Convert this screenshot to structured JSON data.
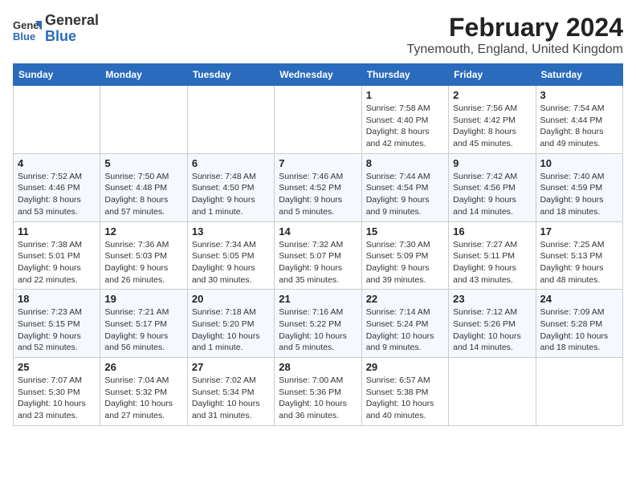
{
  "logo": {
    "general": "General",
    "blue": "Blue"
  },
  "title": "February 2024",
  "subtitle": "Tynemouth, England, United Kingdom",
  "columns": [
    "Sunday",
    "Monday",
    "Tuesday",
    "Wednesday",
    "Thursday",
    "Friday",
    "Saturday"
  ],
  "weeks": [
    [
      {
        "day": "",
        "info": ""
      },
      {
        "day": "",
        "info": ""
      },
      {
        "day": "",
        "info": ""
      },
      {
        "day": "",
        "info": ""
      },
      {
        "day": "1",
        "info": "Sunrise: 7:58 AM\nSunset: 4:40 PM\nDaylight: 8 hours\nand 42 minutes."
      },
      {
        "day": "2",
        "info": "Sunrise: 7:56 AM\nSunset: 4:42 PM\nDaylight: 8 hours\nand 45 minutes."
      },
      {
        "day": "3",
        "info": "Sunrise: 7:54 AM\nSunset: 4:44 PM\nDaylight: 8 hours\nand 49 minutes."
      }
    ],
    [
      {
        "day": "4",
        "info": "Sunrise: 7:52 AM\nSunset: 4:46 PM\nDaylight: 8 hours\nand 53 minutes."
      },
      {
        "day": "5",
        "info": "Sunrise: 7:50 AM\nSunset: 4:48 PM\nDaylight: 8 hours\nand 57 minutes."
      },
      {
        "day": "6",
        "info": "Sunrise: 7:48 AM\nSunset: 4:50 PM\nDaylight: 9 hours\nand 1 minute."
      },
      {
        "day": "7",
        "info": "Sunrise: 7:46 AM\nSunset: 4:52 PM\nDaylight: 9 hours\nand 5 minutes."
      },
      {
        "day": "8",
        "info": "Sunrise: 7:44 AM\nSunset: 4:54 PM\nDaylight: 9 hours\nand 9 minutes."
      },
      {
        "day": "9",
        "info": "Sunrise: 7:42 AM\nSunset: 4:56 PM\nDaylight: 9 hours\nand 14 minutes."
      },
      {
        "day": "10",
        "info": "Sunrise: 7:40 AM\nSunset: 4:59 PM\nDaylight: 9 hours\nand 18 minutes."
      }
    ],
    [
      {
        "day": "11",
        "info": "Sunrise: 7:38 AM\nSunset: 5:01 PM\nDaylight: 9 hours\nand 22 minutes."
      },
      {
        "day": "12",
        "info": "Sunrise: 7:36 AM\nSunset: 5:03 PM\nDaylight: 9 hours\nand 26 minutes."
      },
      {
        "day": "13",
        "info": "Sunrise: 7:34 AM\nSunset: 5:05 PM\nDaylight: 9 hours\nand 30 minutes."
      },
      {
        "day": "14",
        "info": "Sunrise: 7:32 AM\nSunset: 5:07 PM\nDaylight: 9 hours\nand 35 minutes."
      },
      {
        "day": "15",
        "info": "Sunrise: 7:30 AM\nSunset: 5:09 PM\nDaylight: 9 hours\nand 39 minutes."
      },
      {
        "day": "16",
        "info": "Sunrise: 7:27 AM\nSunset: 5:11 PM\nDaylight: 9 hours\nand 43 minutes."
      },
      {
        "day": "17",
        "info": "Sunrise: 7:25 AM\nSunset: 5:13 PM\nDaylight: 9 hours\nand 48 minutes."
      }
    ],
    [
      {
        "day": "18",
        "info": "Sunrise: 7:23 AM\nSunset: 5:15 PM\nDaylight: 9 hours\nand 52 minutes."
      },
      {
        "day": "19",
        "info": "Sunrise: 7:21 AM\nSunset: 5:17 PM\nDaylight: 9 hours\nand 56 minutes."
      },
      {
        "day": "20",
        "info": "Sunrise: 7:18 AM\nSunset: 5:20 PM\nDaylight: 10 hours\nand 1 minute."
      },
      {
        "day": "21",
        "info": "Sunrise: 7:16 AM\nSunset: 5:22 PM\nDaylight: 10 hours\nand 5 minutes."
      },
      {
        "day": "22",
        "info": "Sunrise: 7:14 AM\nSunset: 5:24 PM\nDaylight: 10 hours\nand 9 minutes."
      },
      {
        "day": "23",
        "info": "Sunrise: 7:12 AM\nSunset: 5:26 PM\nDaylight: 10 hours\nand 14 minutes."
      },
      {
        "day": "24",
        "info": "Sunrise: 7:09 AM\nSunset: 5:28 PM\nDaylight: 10 hours\nand 18 minutes."
      }
    ],
    [
      {
        "day": "25",
        "info": "Sunrise: 7:07 AM\nSunset: 5:30 PM\nDaylight: 10 hours\nand 23 minutes."
      },
      {
        "day": "26",
        "info": "Sunrise: 7:04 AM\nSunset: 5:32 PM\nDaylight: 10 hours\nand 27 minutes."
      },
      {
        "day": "27",
        "info": "Sunrise: 7:02 AM\nSunset: 5:34 PM\nDaylight: 10 hours\nand 31 minutes."
      },
      {
        "day": "28",
        "info": "Sunrise: 7:00 AM\nSunset: 5:36 PM\nDaylight: 10 hours\nand 36 minutes."
      },
      {
        "day": "29",
        "info": "Sunrise: 6:57 AM\nSunset: 5:38 PM\nDaylight: 10 hours\nand 40 minutes."
      },
      {
        "day": "",
        "info": ""
      },
      {
        "day": "",
        "info": ""
      }
    ]
  ]
}
